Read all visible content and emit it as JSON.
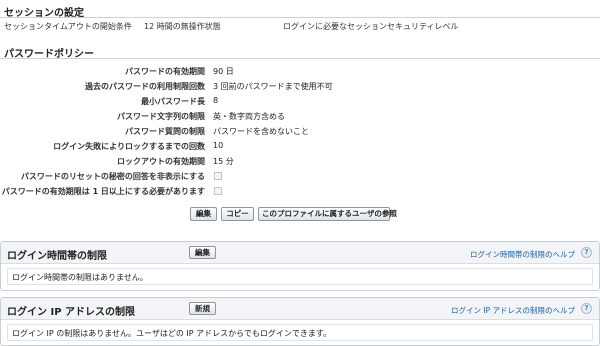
{
  "session": {
    "heading": "セッションの設定",
    "timeout_label": "セッションタイムアウトの開始条件",
    "timeout_value": "12 時間の無操作状態",
    "security_level_label": "ログインに必要なセッションセキュリティレベル"
  },
  "password_policy": {
    "heading": "パスワードポリシー",
    "rows": [
      {
        "label": "パスワードの有効期間",
        "value": "90 日"
      },
      {
        "label": "過去のパスワードの利用制限回数",
        "value": "3 回前のパスワードまで使用不可"
      },
      {
        "label": "最小パスワード長",
        "value": "8"
      },
      {
        "label": "パスワード文字列の制限",
        "value": "英・数字両方含める"
      },
      {
        "label": "パスワード質問の制限",
        "value": "パスワードを含めないこと"
      },
      {
        "label": "ログイン失敗によりロックするまでの回数",
        "value": "10"
      },
      {
        "label": "ロックアウトの有効期間",
        "value": "15 分"
      }
    ],
    "checkbox_rows": [
      {
        "label": "パスワードのリセットの秘密の回答を非表示にする"
      },
      {
        "label": "パスワードの有効期限は 1 日以上にする必要があります"
      }
    ],
    "buttons": {
      "edit": "編集",
      "copy": "コピー",
      "view_users": "このプロファイルに属するユーザの参照"
    }
  },
  "login_hours": {
    "title": "ログイン時間帯の制限",
    "button": "編集",
    "help": "ログイン時間帯の制限のヘルプ",
    "help_icon": "?",
    "body": "ログイン時間帯の制限はありません。"
  },
  "login_ip": {
    "title": "ログイン IP アドレスの制限",
    "button": "新規",
    "help": "ログイン IP アドレスの制限のヘルプ",
    "help_icon": "?",
    "body": "ログイン IP の制限はありません。ユーザはどの IP アドレスからでもログインできます。"
  }
}
